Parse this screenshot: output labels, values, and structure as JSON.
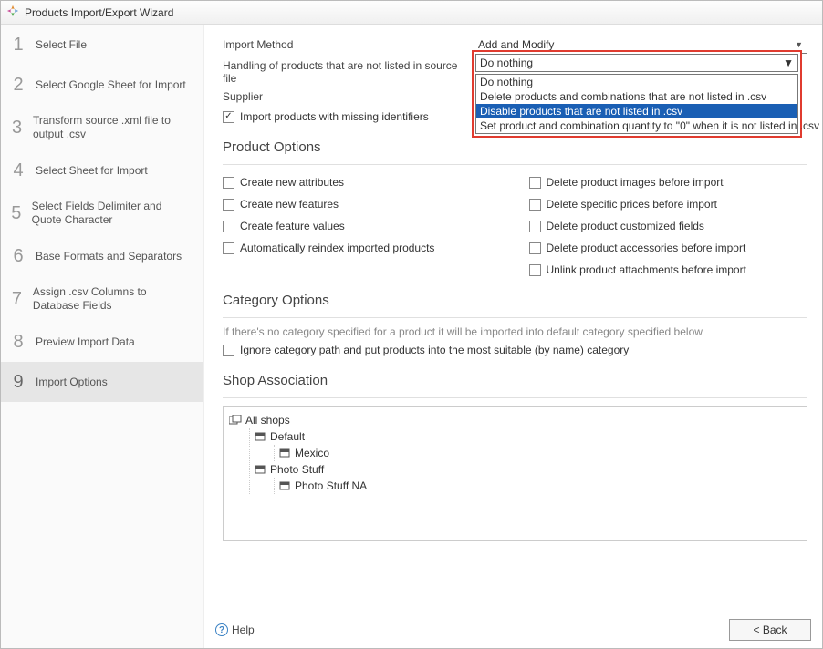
{
  "window": {
    "title": "Products Import/Export Wizard"
  },
  "sidebar": {
    "steps": [
      {
        "num": "1",
        "label": "Select File"
      },
      {
        "num": "2",
        "label": "Select Google Sheet for Import"
      },
      {
        "num": "3",
        "label": "Transform source .xml file to output .csv"
      },
      {
        "num": "4",
        "label": "Select Sheet for Import"
      },
      {
        "num": "5",
        "label": "Select Fields Delimiter and Quote Character"
      },
      {
        "num": "6",
        "label": "Base Formats and Separators"
      },
      {
        "num": "7",
        "label": "Assign .csv Columns to Database Fields"
      },
      {
        "num": "8",
        "label": "Preview Import Data"
      },
      {
        "num": "9",
        "label": "Import Options"
      }
    ],
    "active_index": 8
  },
  "form": {
    "import_method_label": "Import Method",
    "import_method_value": "Add and Modify",
    "handling_label": "Handling of products that are not listed in source file",
    "handling_value": "Do nothing",
    "handling_options": [
      "Do nothing",
      "Delete products and combinations that are not listed in .csv",
      "Disable products that are not listed in .csv",
      "Set product and combination quantity to \"0\" when it is not listed in .csv"
    ],
    "handling_selected_index": 2,
    "supplier_label": "Supplier",
    "import_missing_label": "Import products with missing identifiers"
  },
  "product_options": {
    "heading": "Product Options",
    "left": [
      "Create new attributes",
      "Create new features",
      "Create feature values",
      "Automatically reindex imported products"
    ],
    "right": [
      "Delete product images before import",
      "Delete specific prices before import",
      "Delete product customized fields",
      "Delete product accessories before import",
      "Unlink product attachments before import"
    ]
  },
  "category_options": {
    "heading": "Category Options",
    "note": "If there's no category specified for a product it will be imported into default category specified below",
    "ignore_label": "Ignore category path and put products into the most suitable (by name) category"
  },
  "shop_assoc": {
    "heading": "Shop Association",
    "root": "All shops",
    "children": [
      {
        "name": "Default",
        "children": [
          "Mexico"
        ]
      },
      {
        "name": "Photo Stuff",
        "children": [
          "Photo Stuff NA"
        ]
      }
    ]
  },
  "footer": {
    "help": "Help",
    "back": "< Back"
  }
}
